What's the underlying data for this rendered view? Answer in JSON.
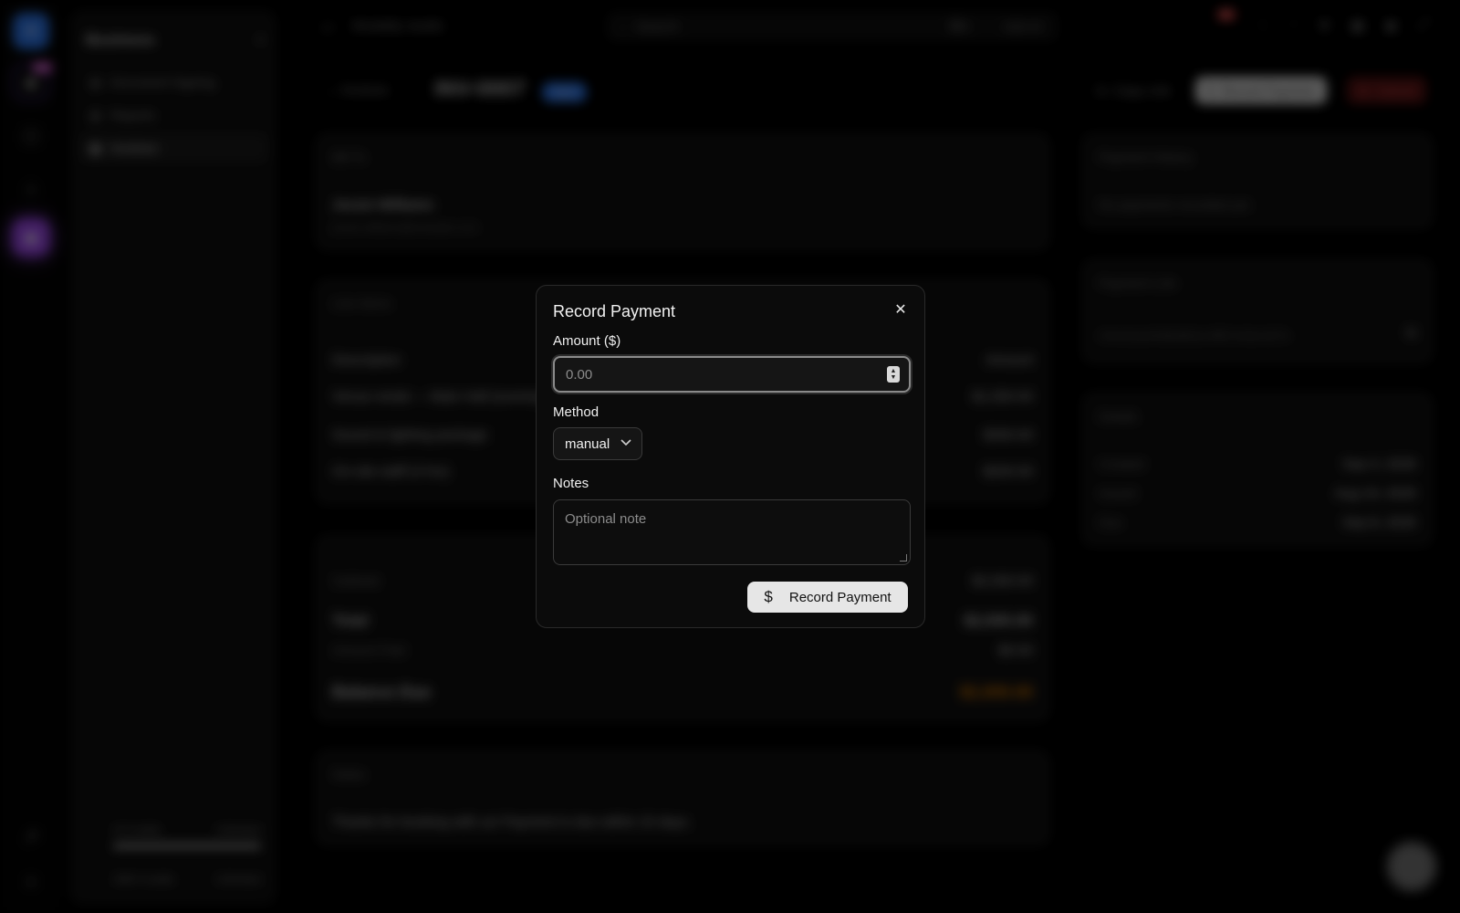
{
  "rail": {
    "badge": "99+"
  },
  "sidebar": {
    "title": "Business",
    "items": [
      {
        "label": "Document Signing"
      },
      {
        "label": "Reports"
      },
      {
        "label": "Invoices"
      }
    ],
    "credits_label": "AI Credits",
    "credits_value": "Unlimited",
    "sms_label": "SMS Credits",
    "sms_value": "Unlimited"
  },
  "topbar": {
    "title": "Modality studio",
    "search_placeholder": "Search",
    "shortcut": "⌘K",
    "ask_ai": "Ask AI",
    "notif_badge": "9+"
  },
  "invoice": {
    "back_label": "Invoices",
    "number": "INV-0007",
    "status": "Sent",
    "copy_link": "Copy Link",
    "record_payment": "Record Payment",
    "cancel": "Cancel",
    "bill_to_label": "Bill To",
    "customer_name": "Jessie Williams",
    "customer_email": "jessie.williams@example.com",
    "line_items_label": "Line Items",
    "col_description": "Description",
    "col_amount": "Amount",
    "lines": [
      {
        "desc": "Venue rental — Main Hall (evening)",
        "amount": "$1,500.00"
      },
      {
        "desc": "Sound & lighting package",
        "amount": "$300.00"
      },
      {
        "desc": "On-site staff (4 hrs)",
        "amount": "$200.00"
      }
    ],
    "subtotal_label": "Subtotal",
    "subtotal": "$2,000.00",
    "total_label": "Total",
    "total": "$2,000.00",
    "paid_label": "Amount Paid",
    "paid": "$0.00",
    "balance_label": "Balance Due",
    "balance": "$2,000.00",
    "notes_label": "Notes",
    "notes": "Thanks for booking with us! Payment is due within 15 days.",
    "history_label": "Payment History",
    "history_empty": "No payments recorded yet.",
    "link_label": "Payment Link",
    "link_url": "/checkout/4d9e8b2a-8f6f-4c9a-b27e",
    "details_label": "Details",
    "details": [
      {
        "k": "Created",
        "v": "Sep 3, 2026"
      },
      {
        "k": "Issued",
        "v": "Aug 19, 2026"
      },
      {
        "k": "Due",
        "v": "Sep 8, 2026"
      }
    ]
  },
  "modal": {
    "title": "Record Payment",
    "amount_label": "Amount ($)",
    "amount_placeholder": "0.00",
    "method_label": "Method",
    "method_value": "manual",
    "notes_label": "Notes",
    "notes_placeholder": "Optional note",
    "submit_label": "Record Payment"
  },
  "colors": {
    "accent_blue": "#2f7cf6",
    "accent_purple": "#a54df7",
    "balance_orange": "#e07b00",
    "danger_red": "#e05050"
  }
}
